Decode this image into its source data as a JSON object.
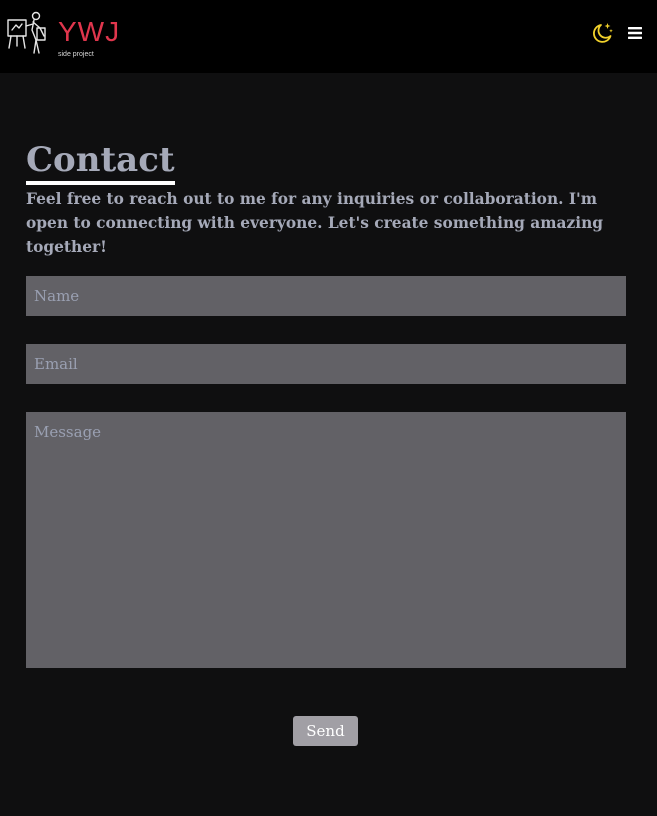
{
  "brand": {
    "name": "YWJ",
    "tagline": "side project",
    "accent_color": "#e0364d"
  },
  "header": {
    "theme_toggle_icon": "moon-stars-icon",
    "menu_icon": "hamburger-menu-icon"
  },
  "contact": {
    "title": "Contact",
    "intro": "Feel free to reach out to me for any inquiries or collaboration. I'm open to connecting with everyone. Let's create something amazing together!",
    "name_placeholder": "Name",
    "name_value": "",
    "email_placeholder": "Email",
    "email_value": "",
    "message_placeholder": "Message",
    "message_value": "",
    "send_label": "Send"
  }
}
